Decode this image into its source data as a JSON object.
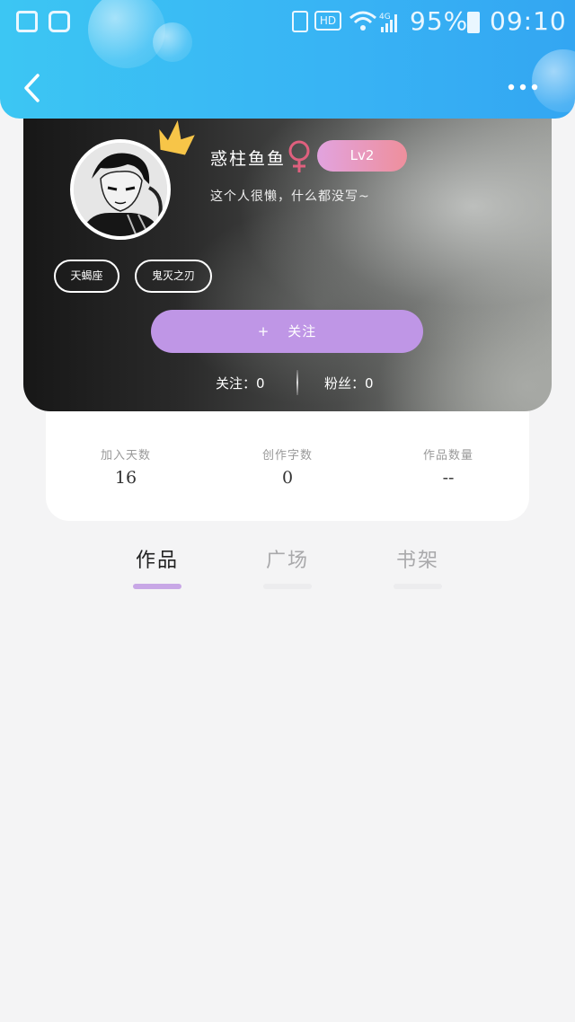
{
  "status_bar": {
    "battery_percent": "95%",
    "time": "09:10",
    "hd_label": "HD",
    "network_label": "4G"
  },
  "profile": {
    "nickname": "惑柱鱼鱼",
    "gender_symbol": "♀",
    "level": "Lv2",
    "bio": "这个人很懒，什么都没写~",
    "tags": [
      "天蝎座",
      "鬼灭之刃"
    ],
    "follow_button": {
      "icon": "+",
      "label": "关注"
    },
    "following": "关注：0",
    "fans": "粉丝：0"
  },
  "stats": [
    {
      "label": "加入天数",
      "value": "16"
    },
    {
      "label": "创作字数",
      "value": "0"
    },
    {
      "label": "作品数量",
      "value": "--"
    }
  ],
  "tabs": [
    {
      "label": "作品",
      "active": true
    },
    {
      "label": "广场",
      "active": false
    },
    {
      "label": "书架",
      "active": false
    }
  ],
  "colors": {
    "header_blue": "#38b3f4",
    "follow_purple": "#bf96e6",
    "level_gradient_start": "#e2a3df",
    "level_gradient_end": "#ee8f9c",
    "gender_pink": "#e0607e",
    "crown_yellow": "#f7c548",
    "tab_underline_active": "#c8a7e6"
  }
}
